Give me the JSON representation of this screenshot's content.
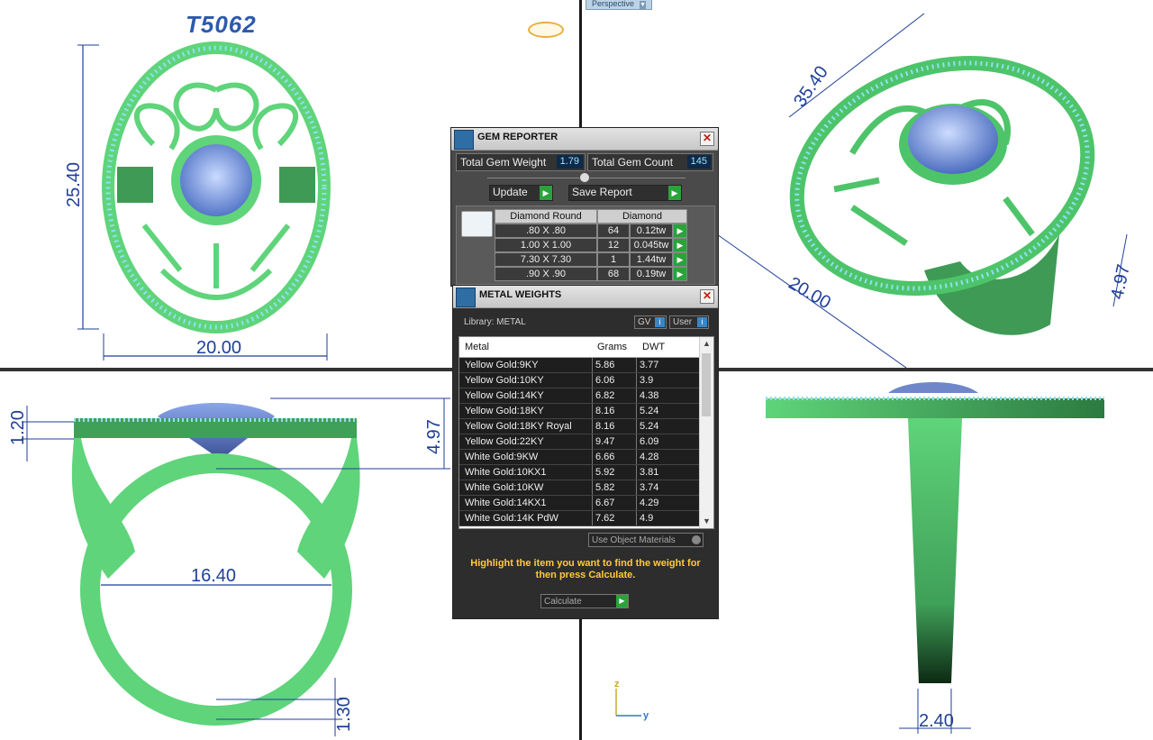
{
  "top_view": {
    "title": "T5062",
    "dim_height": "25.40",
    "dim_width": "20.00"
  },
  "perspective_view": {
    "tab_label": "Perspective",
    "dim_top": "35.40",
    "dim_width": "20.00",
    "dim_right": "4.97"
  },
  "front_view": {
    "dim_left_top": "1.20",
    "dim_right_height": "4.97",
    "dim_inner": "16.40",
    "dim_bottom": "1.30"
  },
  "right_view": {
    "dim_shank": "2.40",
    "axis_z": "z",
    "axis_y": "y"
  },
  "gem_reporter": {
    "title": "GEM REPORTER",
    "total_weight_label": "Total Gem Weight",
    "total_weight_value": "1.79",
    "total_count_label": "Total Gem Count",
    "total_count_value": "145",
    "update_label": "Update",
    "save_label": "Save Report",
    "table": {
      "shape_header": "Diamond Round",
      "material_header": "Diamond",
      "rows": [
        {
          "size": ".80 X .80",
          "count": "64",
          "weight": "0.12tw"
        },
        {
          "size": "1.00 X 1.00",
          "count": "12",
          "weight": "0.045tw"
        },
        {
          "size": "7.30 X 7.30",
          "count": "1",
          "weight": "1.44tw"
        },
        {
          "size": ".90 X .90",
          "count": "68",
          "weight": "0.19tw"
        }
      ]
    }
  },
  "metal_weights": {
    "title": "METAL WEIGHTS",
    "library_label": "Library: METAL",
    "gv_label": "GV",
    "user_label": "User",
    "columns": [
      "Metal",
      "Grams",
      "DWT"
    ],
    "rows": [
      {
        "metal": "Yellow Gold:9KY",
        "grams": "5.86",
        "dwt": "3.77"
      },
      {
        "metal": "Yellow Gold:10KY",
        "grams": "6.06",
        "dwt": "3.9"
      },
      {
        "metal": "Yellow Gold:14KY",
        "grams": "6.82",
        "dwt": "4.38"
      },
      {
        "metal": "Yellow Gold:18KY",
        "grams": "8.16",
        "dwt": "5.24"
      },
      {
        "metal": "Yellow Gold:18KY Royal",
        "grams": "8.16",
        "dwt": "5.24"
      },
      {
        "metal": "Yellow Gold:22KY",
        "grams": "9.47",
        "dwt": "6.09"
      },
      {
        "metal": "White Gold:9KW",
        "grams": "6.66",
        "dwt": "4.28"
      },
      {
        "metal": "White Gold:10KX1",
        "grams": "5.92",
        "dwt": "3.81"
      },
      {
        "metal": "White Gold:10KW",
        "grams": "5.82",
        "dwt": "3.74"
      },
      {
        "metal": "White Gold:14KX1",
        "grams": "6.67",
        "dwt": "4.29"
      },
      {
        "metal": "White Gold:14K PdW",
        "grams": "7.62",
        "dwt": "4.9"
      }
    ],
    "use_object_label": "Use Object Materials",
    "hint": "Highlight the item you want to find the weight for then press Calculate.",
    "calculate_label": "Calculate"
  },
  "colors": {
    "ring_green": "#5fd47a",
    "gem_blue": "#7d9fe6",
    "dimension_blue": "#1f3f9a",
    "hint_yellow": "#ffcc33",
    "go_green": "#2aa33a"
  }
}
